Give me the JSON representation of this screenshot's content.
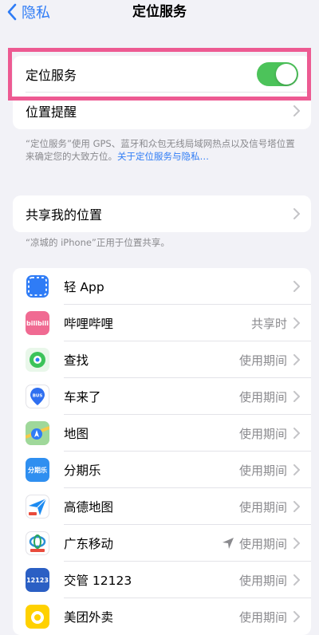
{
  "nav": {
    "back_label": "隐私",
    "title": "定位服务"
  },
  "location_services": {
    "label": "定位服务",
    "enabled": true
  },
  "location_alerts": {
    "label": "位置提醒"
  },
  "footnote1": {
    "text": "“定位服务”使用 GPS、蓝牙和众包无线局域网热点以及信号塔位置来确定您的大致方位。",
    "link": "关于定位服务与隐私…"
  },
  "share_location": {
    "label": "共享我的位置"
  },
  "footnote2": {
    "text": "“凉城的 iPhone”正用于位置共享。"
  },
  "apps": [
    {
      "name": "轻 App",
      "status": ""
    },
    {
      "name": "哔哩哔哩",
      "status": "共享时"
    },
    {
      "name": "查找",
      "status": "使用期间"
    },
    {
      "name": "车来了",
      "status": "使用期间"
    },
    {
      "name": "地图",
      "status": "使用期间"
    },
    {
      "name": "分期乐",
      "status": "使用期间"
    },
    {
      "name": "高德地图",
      "status": "使用期间"
    },
    {
      "name": "广东移动",
      "status": "使用期间"
    },
    {
      "name": "交管 12123",
      "status": "使用期间"
    },
    {
      "name": "美团外卖",
      "status": "使用期间"
    }
  ],
  "icons": {
    "bilibili_text": "bilibili",
    "chelaile_text": "BUS",
    "fenqile_text": "分期乐",
    "jiaoguan_text": "12123"
  },
  "colors": {
    "accent": "#2f7cf6",
    "toggle_on": "#4cc35a",
    "highlight": "#ed5a92",
    "background": "#f2f2f7"
  }
}
